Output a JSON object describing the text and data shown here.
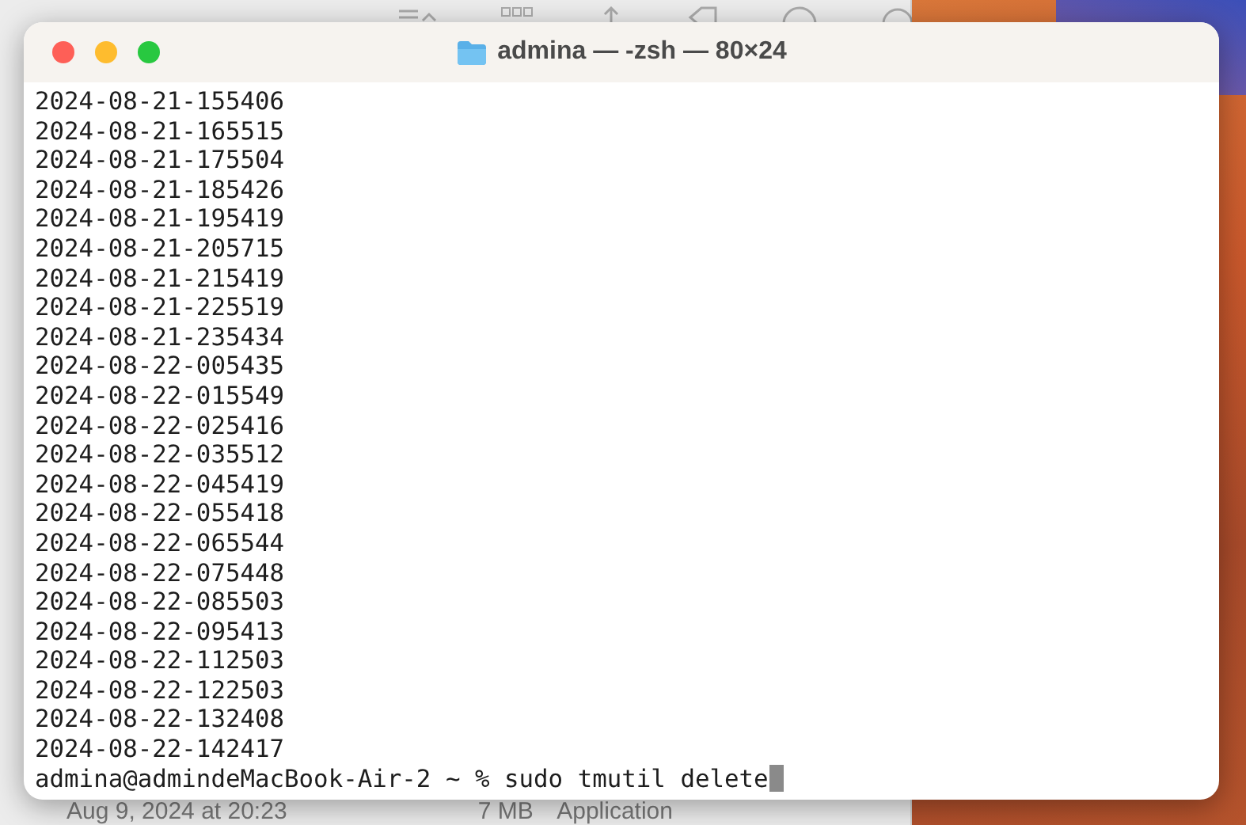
{
  "background_window": {
    "row": [
      "Aug 9, 2024 at 20:23",
      "7 MB",
      "Application"
    ]
  },
  "terminal": {
    "title": "admina — -zsh — 80×24",
    "lines": [
      "2024-08-21-155406",
      "2024-08-21-165515",
      "2024-08-21-175504",
      "2024-08-21-185426",
      "2024-08-21-195419",
      "2024-08-21-205715",
      "2024-08-21-215419",
      "2024-08-21-225519",
      "2024-08-21-235434",
      "2024-08-22-005435",
      "2024-08-22-015549",
      "2024-08-22-025416",
      "2024-08-22-035512",
      "2024-08-22-045419",
      "2024-08-22-055418",
      "2024-08-22-065544",
      "2024-08-22-075448",
      "2024-08-22-085503",
      "2024-08-22-095413",
      "2024-08-22-112503",
      "2024-08-22-122503",
      "2024-08-22-132408",
      "2024-08-22-142417"
    ],
    "prompt": "admina@admindeMacBook-Air-2 ~ % sudo tmutil delete"
  }
}
